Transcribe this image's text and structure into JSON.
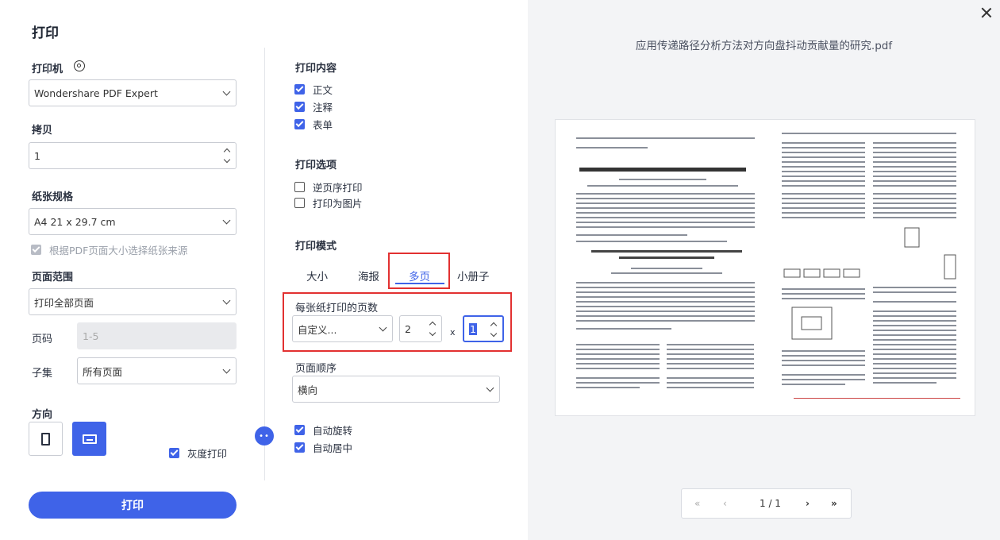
{
  "dialog": {
    "title": "打印",
    "close_icon": "close-icon"
  },
  "left": {
    "printer_label": "打印机",
    "printer_value": "Wondershare PDF Expert",
    "copies_label": "拷贝",
    "copies_value": "1",
    "paper_label": "纸张规格",
    "paper_value": "A4 21 x 29.7 cm",
    "fit_paper_label": "根据PDF页面大小选择纸张来源",
    "range_label": "页面范围",
    "range_value": "打印全部页面",
    "pages_label": "页码",
    "pages_value": "1-5",
    "subset_label": "子集",
    "subset_value": "所有页面",
    "orientation_label": "方向",
    "grayscale_label": "灰度打印",
    "print_button": "打印"
  },
  "middle": {
    "content_label": "打印内容",
    "content_items": [
      "正文",
      "注释",
      "表单"
    ],
    "options_label": "打印选项",
    "options_items": [
      "逆页序打印",
      "打印为图片"
    ],
    "mode_label": "打印模式",
    "tabs": [
      "大小",
      "海报",
      "多页",
      "小册子"
    ],
    "active_tab": "多页",
    "per_sheet_label": "每张纸打印的页数",
    "per_sheet_select": "自定义...",
    "cols_value": "2",
    "times": "x",
    "rows_value": "1",
    "page_order_label": "页面顺序",
    "page_order_value": "横向",
    "auto_rotate_label": "自动旋转",
    "auto_center_label": "自动居中"
  },
  "preview": {
    "filename": "应用传递路径分析方法对方向盘抖动贡献量的研究.pdf",
    "page_indicator": "1 / 1",
    "first_icon": "«",
    "prev_icon": "‹",
    "next_icon": "›",
    "last_icon": "»"
  },
  "colors": {
    "accent": "#3f63e8",
    "highlight_border": "#e23131"
  }
}
